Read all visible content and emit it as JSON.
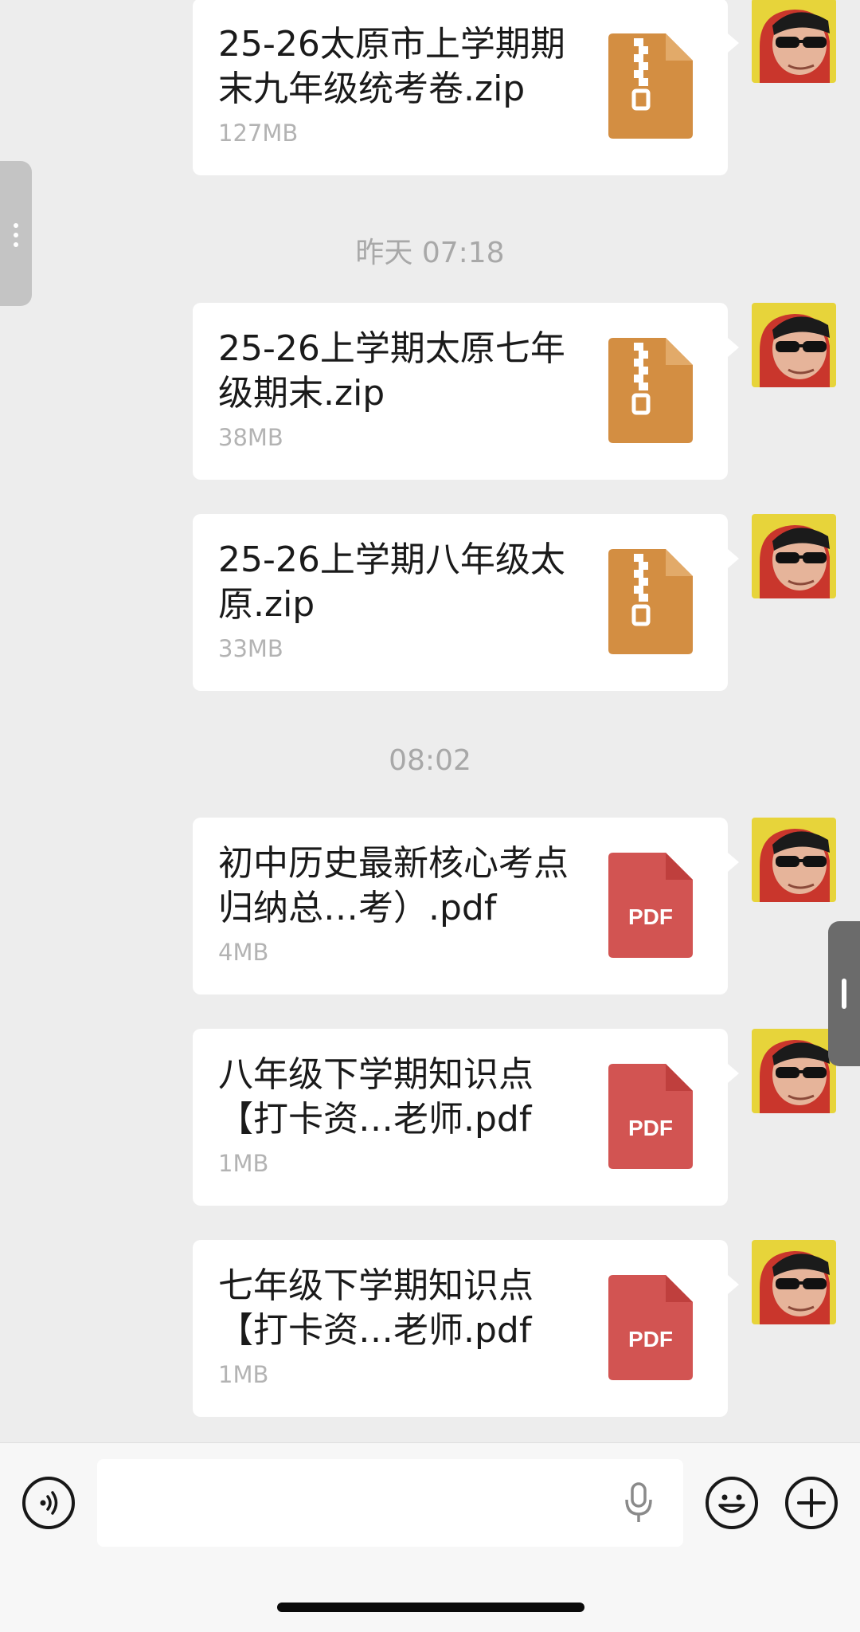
{
  "timestamps": [
    "昨天 07:18",
    "08:02"
  ],
  "messages": [
    {
      "name": "25-26太原市上学期期末九年级统考卷.zip",
      "size": "127MB",
      "type": "zip"
    },
    {
      "name": "25-26上学期太原七年级期末.zip",
      "size": "38MB",
      "type": "zip"
    },
    {
      "name": "25-26上学期八年级太原.zip",
      "size": "33MB",
      "type": "zip"
    },
    {
      "name": "初中历史最新核心考点归纳总…考）.pdf",
      "size": "4MB",
      "type": "pdf",
      "badge": "PDF"
    },
    {
      "name": "八年级下学期知识点【打卡资…老师.pdf",
      "size": "1MB",
      "type": "pdf",
      "badge": "PDF"
    },
    {
      "name": "七年级下学期知识点【打卡资…老师.pdf",
      "size": "1MB",
      "type": "pdf",
      "badge": "PDF"
    }
  ],
  "colors": {
    "zip": "#d38e42",
    "zip_fold": "#e2aa69",
    "pdf": "#d25452",
    "pdf_fold": "#bf3f3d"
  },
  "icons": {
    "voice": "voice-mode-icon",
    "mic": "microphone-icon",
    "emoji": "emoji-icon",
    "add": "plus-icon"
  }
}
